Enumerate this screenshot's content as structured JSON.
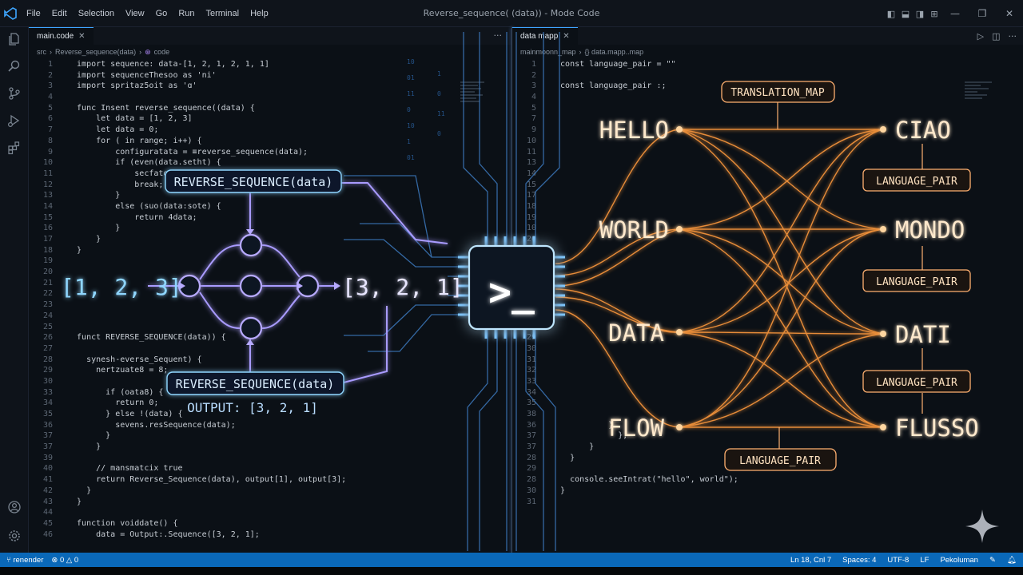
{
  "titlebar": {
    "menu": [
      "File",
      "Edit",
      "Selection",
      "View",
      "Go",
      "Run",
      "Terminal",
      "Help"
    ],
    "window_title": "Reverse_sequence( (data)) - Mode Code"
  },
  "left_editor": {
    "tab": "main.code",
    "breadcrumb": [
      "src",
      "Reverse_sequence(data)",
      "code"
    ],
    "lines": [
      {
        "n": "1",
        "t": "  import sequence: data-[1, 2, 1, 2, 1, 1]"
      },
      {
        "n": "2",
        "t": "  import sequenceThesoo as 'ni'"
      },
      {
        "n": "3",
        "t": "  import spritaz5oit as 'ɑ'"
      },
      {
        "n": "4",
        "t": ""
      },
      {
        "n": "5",
        "t": "  func Insent reverse_sequence((data) {"
      },
      {
        "n": "6",
        "t": "      let data = [1, 2, 3]"
      },
      {
        "n": "7",
        "t": "      let data = 0;"
      },
      {
        "n": "8",
        "t": "      for ( in range; i++) {"
      },
      {
        "n": "9",
        "t": "          configuratata = ≡reverse_sequence(data);"
      },
      {
        "n": "10",
        "t": "          if (even(data.setht) {"
      },
      {
        "n": "11",
        "t": "              secfatos;"
      },
      {
        "n": "12",
        "t": "              break;"
      },
      {
        "n": "13",
        "t": "          }"
      },
      {
        "n": "14",
        "t": "          else (suo(data:sote) {"
      },
      {
        "n": "15",
        "t": "              return 4data;"
      },
      {
        "n": "16",
        "t": "          }"
      },
      {
        "n": "17",
        "t": "      }"
      },
      {
        "n": "18",
        "t": "  }"
      },
      {
        "n": "19",
        "t": ""
      },
      {
        "n": "20",
        "t": ""
      },
      {
        "n": "21",
        "t": ""
      },
      {
        "n": "22",
        "t": ""
      },
      {
        "n": "23",
        "t": ""
      },
      {
        "n": "24",
        "t": ""
      },
      {
        "n": "25",
        "t": ""
      },
      {
        "n": "26",
        "t": "  funct REVERSE_SEQUENCE(data)) {"
      },
      {
        "n": "27",
        "t": ""
      },
      {
        "n": "28",
        "t": "    synesh-everse_Sequent) {"
      },
      {
        "n": "29",
        "t": "      nertzuate8 = 8;"
      },
      {
        "n": "30",
        "t": ""
      },
      {
        "n": "33",
        "t": "        if (oata8) {"
      },
      {
        "n": "34",
        "t": "          return 0;"
      },
      {
        "n": "35",
        "t": "        } else !(data) {"
      },
      {
        "n": "36",
        "t": "          sevens.resSequence(data);"
      },
      {
        "n": "37",
        "t": "        }"
      },
      {
        "n": "37",
        "t": "      }"
      },
      {
        "n": "39",
        "t": ""
      },
      {
        "n": "40",
        "t": "      // mansmatcix true"
      },
      {
        "n": "41",
        "t": "      return Reverse_Sequence(data), output[1], output[3];"
      },
      {
        "n": "42",
        "t": "    }"
      },
      {
        "n": "43",
        "t": "  }"
      },
      {
        "n": "44",
        "t": ""
      },
      {
        "n": "45",
        "t": "  function voiddate() {"
      },
      {
        "n": "46",
        "t": "      data = Output:.Sequence([3, 2, 1];"
      }
    ]
  },
  "right_editor": {
    "tab": "data mapp",
    "breadcrumb": [
      "mainmoonn_map",
      "{} data.mapp..map"
    ],
    "lines": [
      {
        "n": "1",
        "t": "  const language_pair = \"\""
      },
      {
        "n": "2",
        "t": ""
      },
      {
        "n": "3",
        "t": "  const language_pair :;"
      },
      {
        "n": "4",
        "t": ""
      },
      {
        "n": "5",
        "t": ""
      },
      {
        "n": "7",
        "t": ""
      },
      {
        "n": "9",
        "t": ""
      },
      {
        "n": "10",
        "t": ""
      },
      {
        "n": "11",
        "t": ""
      },
      {
        "n": "13",
        "t": ""
      },
      {
        "n": "14",
        "t": ""
      },
      {
        "n": "15",
        "t": ""
      },
      {
        "n": "17",
        "t": ""
      },
      {
        "n": "18",
        "t": ""
      },
      {
        "n": "19",
        "t": ""
      },
      {
        "n": "10",
        "t": ""
      },
      {
        "n": "20",
        "t": ""
      },
      {
        "n": "21",
        "t": ""
      },
      {
        "n": "22",
        "t": ""
      },
      {
        "n": "23",
        "t": ""
      },
      {
        "n": "24",
        "t": ""
      },
      {
        "n": "25",
        "t": ""
      },
      {
        "n": "26",
        "t": ""
      },
      {
        "n": "27",
        "t": ""
      },
      {
        "n": "28",
        "t": ""
      },
      {
        "n": "29",
        "t": ""
      },
      {
        "n": "30",
        "t": ""
      },
      {
        "n": "31",
        "t": ""
      },
      {
        "n": "32",
        "t": ""
      },
      {
        "n": "33",
        "t": ""
      },
      {
        "n": "34",
        "t": ""
      },
      {
        "n": "35",
        "t": ""
      },
      {
        "n": "38",
        "t": ""
      },
      {
        "n": "36",
        "t": "            }."
      },
      {
        "n": "37",
        "t": "              },"
      },
      {
        "n": "37",
        "t": "        }"
      },
      {
        "n": "28",
        "t": "    }"
      },
      {
        "n": "29",
        "t": ""
      },
      {
        "n": "28",
        "t": "    console.seeIntrat(\"hello\", world\");"
      },
      {
        "n": "30",
        "t": "  }"
      },
      {
        "n": "31",
        "t": ""
      }
    ]
  },
  "diagram": {
    "input_array": "[1, 2, 3]",
    "output_array": "[3, 2, 1]",
    "reverse_label_top": "REVERSE_SEQUENCE(data)",
    "reverse_label_bottom": "REVERSE_SEQUENCE(data)",
    "output_text": "OUTPUT: [3, 2, 1]",
    "terminal_glyph": ">_",
    "translation_map_label": "TRANSLATION_MAP",
    "language_pair_label": "LANGUAGE_PAIR",
    "source_words": [
      "HELLO",
      "WORLD",
      "DATA",
      "FLOW"
    ],
    "target_words": [
      "CIAO",
      "MONDO",
      "DATI",
      "FLUSSO"
    ],
    "colors": {
      "blue_glow": "#6ec8ff",
      "purple": "#9a8cff",
      "orange_glow": "#ff9a3c",
      "text_cream": "#ffe9cc"
    }
  },
  "statusbar": {
    "branch": "renender",
    "problems": "0 △ 0",
    "cursor": "Ln 18, Cnl 7",
    "spaces": "Spaces: 4",
    "encoding": "UTF-8",
    "eol": "LF",
    "language": "Pekoluman"
  }
}
